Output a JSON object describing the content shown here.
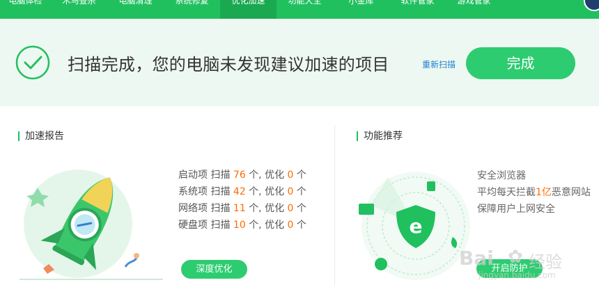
{
  "nav": {
    "items": [
      {
        "label": "电脑体检"
      },
      {
        "label": "木马查杀"
      },
      {
        "label": "电脑清理"
      },
      {
        "label": "系统修复"
      },
      {
        "label": "优化加速"
      },
      {
        "label": "功能大全"
      },
      {
        "label": "小金库"
      },
      {
        "label": "软件管家"
      },
      {
        "label": "游戏管家"
      }
    ],
    "active_index": 4
  },
  "banner": {
    "status": "扫描完成，您的电脑未发现建议加速的项目",
    "rescan_label": "重新扫描",
    "done_label": "完成"
  },
  "report": {
    "title": "加速报告",
    "rows": [
      {
        "name": "启动项",
        "scan_label": "扫描",
        "scanned": "76",
        "unit1": "个, 优化",
        "optimized": "0",
        "unit2": "个"
      },
      {
        "name": "系统项",
        "scan_label": "扫描",
        "scanned": "42",
        "unit1": "个, 优化",
        "optimized": "0",
        "unit2": "个"
      },
      {
        "name": "网络项",
        "scan_label": "扫描",
        "scanned": "11",
        "unit1": "个, 优化",
        "optimized": "0",
        "unit2": "个"
      },
      {
        "name": "硬盘项",
        "scan_label": "扫描",
        "scanned": "10",
        "unit1": "个, 优化",
        "optimized": "0",
        "unit2": "个"
      }
    ],
    "deep_button": "深度优化"
  },
  "feature": {
    "title": "功能推荐",
    "line1": "安全浏览器",
    "line2_prefix": "平均每天拦截",
    "line2_highlight": "1亿",
    "line2_suffix": "恶意网站",
    "line3": "保障用户上网安全",
    "open_button": "开启防护"
  },
  "watermark": {
    "brand": "Bai",
    "brand2": "经验",
    "url": "jingyan.baidu.com"
  },
  "colors": {
    "brand_green": "#21c05f",
    "button_green": "#2ecc71",
    "highlight": "#ff6a00",
    "link": "#1a7fd1"
  }
}
